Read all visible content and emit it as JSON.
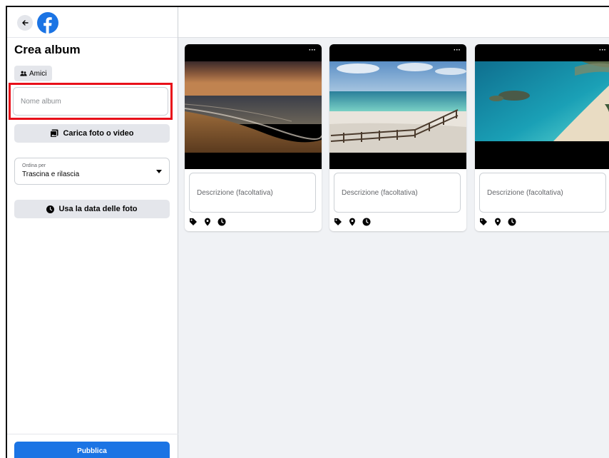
{
  "sidebar": {
    "title": "Crea album",
    "audience_label": "Amici",
    "album_name_placeholder": "Nome album",
    "upload_label": "Carica foto o video",
    "sort": {
      "label": "Ordina per",
      "value": "Trascina e rilascia"
    },
    "photo_date_label": "Usa la data delle foto",
    "publish_label": "Pubblica"
  },
  "photos": [
    {
      "menu": "···",
      "description_placeholder": "Descrizione (facoltativa)"
    },
    {
      "menu": "···",
      "description_placeholder": "Descrizione (facoltativa)"
    },
    {
      "menu": "···",
      "description_placeholder": "Descrizione (facoltativa)"
    }
  ],
  "icons": {
    "back": "arrow-left-icon",
    "logo": "facebook-logo-icon",
    "audience": "people-icon",
    "upload": "photo-add-icon",
    "sort": "caret-down-icon",
    "date": "clock-icon",
    "card": [
      "tag-icon",
      "location-pin-icon",
      "clock-icon"
    ]
  },
  "colors": {
    "brand_blue": "#1b74e4",
    "highlight_red": "#e8101a",
    "background": "#f0f2f5",
    "button_gray": "#e4e6eb"
  }
}
